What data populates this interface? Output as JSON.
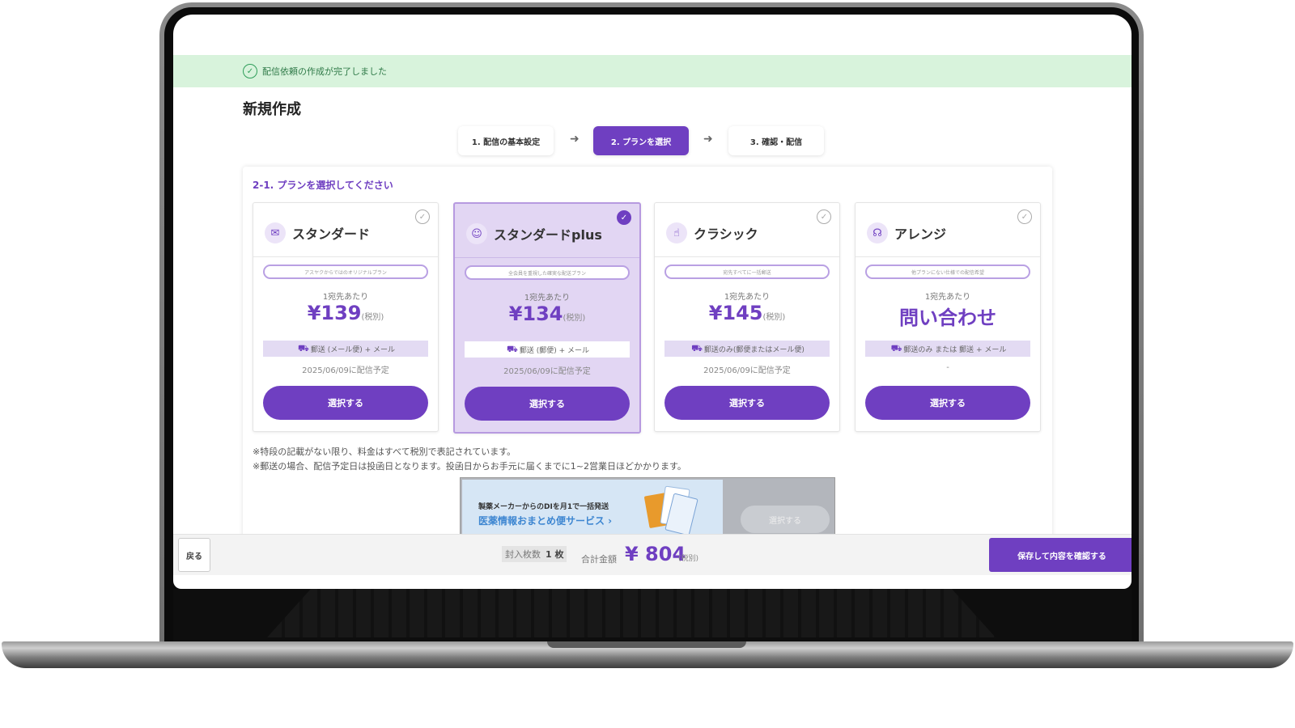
{
  "banner": {
    "message": "配信依頼の作成が完了しました"
  },
  "page": {
    "title": "新規作成"
  },
  "steps": [
    {
      "label": "1. 配信の基本設定"
    },
    {
      "label": "2. プランを選択"
    },
    {
      "label": "3. 確認・配信"
    }
  ],
  "section": {
    "heading": "2-1. プランを選択してください"
  },
  "plans": [
    {
      "name": "スタンダード",
      "icon": "mail-icon",
      "tag": "アスヤクからではのオリジナルプラン",
      "per_label": "1宛先あたり",
      "price": "¥139",
      "tax": "(税別)",
      "method": "郵送 (メール便) + メール",
      "date": "2025/06/09に配信予定",
      "button": "選択する",
      "selected": false
    },
    {
      "name": "スタンダードplus",
      "icon": "group-icon",
      "tag": "全会員を重視した確実な配送プラン",
      "per_label": "1宛先あたり",
      "price": "¥134",
      "tax": "(税別)",
      "method": "郵送 (郵便) + メール",
      "date": "2025/06/09に配信予定",
      "button": "選択する",
      "selected": true
    },
    {
      "name": "クラシック",
      "icon": "hand-icon",
      "tag": "宛先すべてに一括郵送",
      "per_label": "1宛先あたり",
      "price": "¥145",
      "tax": "(税別)",
      "method": "郵送のみ(郵便またはメール便)",
      "date": "2025/06/09に配信予定",
      "button": "選択する",
      "selected": false
    },
    {
      "name": "アレンジ",
      "icon": "headset-icon",
      "tag": "他プランにない仕様での配信希望",
      "per_label": "1宛先あたり",
      "price": "問い合わせ",
      "tax": "",
      "method": "郵送のみ または 郵送 + メール",
      "date": "-",
      "button": "選択する",
      "selected": false
    }
  ],
  "notes": [
    "※特段の記載がない限り、料金はすべて税別で表記されています。",
    "※郵送の場合、配信予定日は投函日となります。投函日からお手元に届くまでに1~2営業日ほどかかります。"
  ],
  "promo": {
    "sub": "製薬メーカーからのDIを月1で一括発送",
    "link": "医薬情報おまとめ便サービス ›",
    "button": "選択する"
  },
  "footer": {
    "back": "戻る",
    "count_label": "封入枚数",
    "count_value": "1 枚",
    "total_label": "合計金額",
    "total_value": "¥ 804",
    "total_tax": "(税別)",
    "save": "保存して内容を確認する"
  },
  "colors": {
    "accent": "#6f3fc1",
    "banner_bg": "#d8f3dc",
    "banner_text": "#2f7a48",
    "selected_card": "#e2d6f3"
  }
}
